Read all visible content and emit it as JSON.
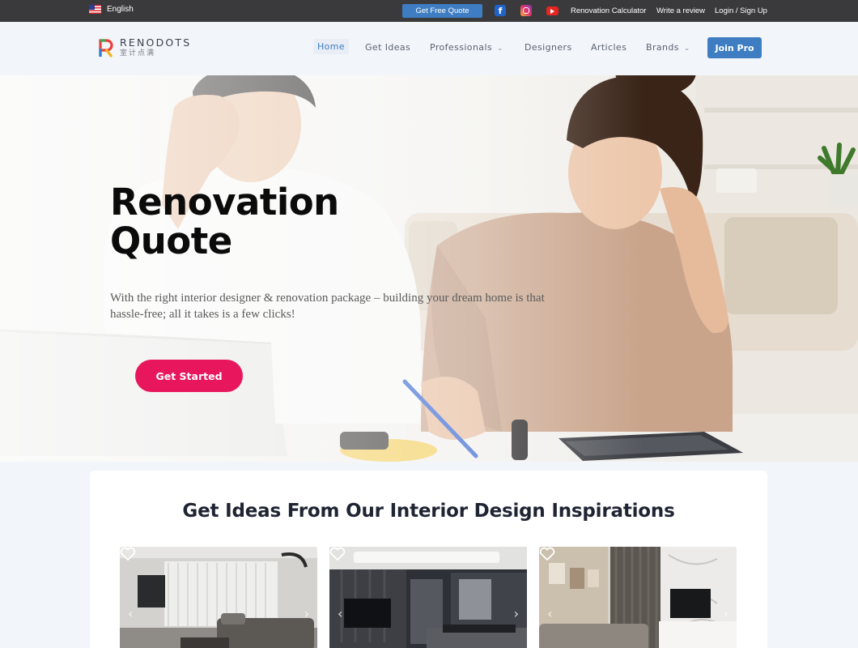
{
  "topbar": {
    "language": "English",
    "quote_button": "Get Free Quote",
    "facebook_glyph": "f",
    "links": [
      "Renovation Calculator",
      "Write a review",
      "Login / Sign Up"
    ]
  },
  "header": {
    "brand_name": "RENODOTS",
    "brand_subtitle": "室计点满",
    "nav": [
      "Home",
      "Get Ideas",
      "Professionals",
      "Designers",
      "Articles",
      "Brands"
    ],
    "active_nav": "Home",
    "join_button": "Join Pro"
  },
  "hero": {
    "title": "Renovation\nQuote",
    "description": "With the right interior designer & renovation package – building your dream home is that hassle-free; all it takes is a few clicks!",
    "cta": "Get Started"
  },
  "ideas": {
    "title": "Get Ideas From Our Interior Design Inspirations",
    "cards": [
      {
        "icon": "heart-icon",
        "arrow_left": "‹",
        "arrow_right": "›"
      },
      {
        "icon": "heart-icon",
        "arrow_left": "‹",
        "arrow_right": "›"
      },
      {
        "icon": "heart-icon",
        "arrow_left": "‹",
        "arrow_right": "›"
      }
    ]
  },
  "colors": {
    "topbar_bg": "#3a3a3c",
    "accent_blue": "#3e7dc2",
    "cta_pink": "#e8175d",
    "page_bg": "#f2f5f9"
  }
}
